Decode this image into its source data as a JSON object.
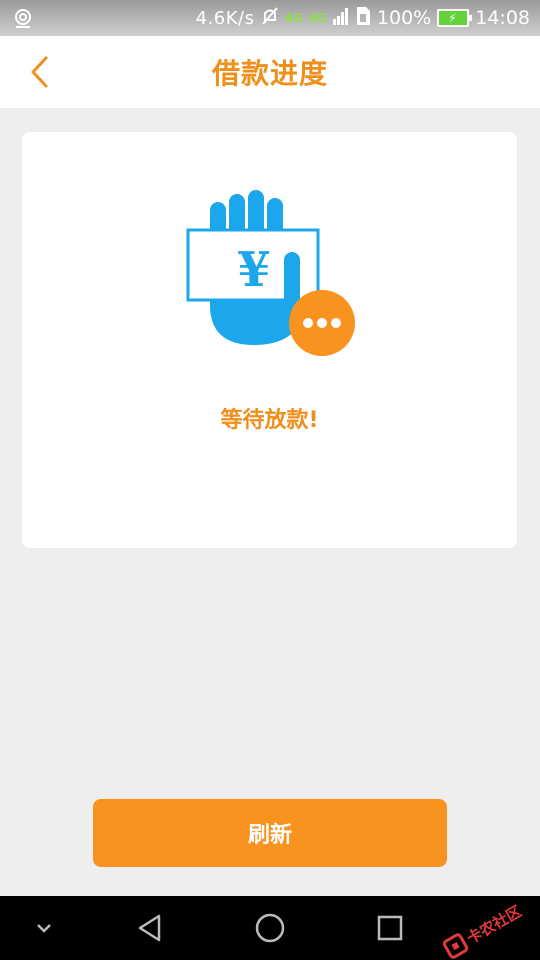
{
  "status_bar": {
    "net_speed": "4.6K/s",
    "network_1": "4G",
    "network_2": "4G",
    "battery_percent": "100%",
    "time": "14:08",
    "battery_level": 1.0
  },
  "header": {
    "title": "借款进度",
    "back_icon": "chevron-left-icon"
  },
  "status_card": {
    "illustration_currency": "¥",
    "message": "等待放款!"
  },
  "actions": {
    "refresh_label": "刷新"
  },
  "nav_bar": {
    "icons": [
      "chevron-down-icon",
      "back-triangle-icon",
      "home-circle-icon",
      "recents-square-icon"
    ]
  },
  "colors": {
    "accent_orange": "#f7931e",
    "title_orange": "#ef8f1c",
    "illustration_blue": "#1ca7ec",
    "background": "#eeeeee"
  }
}
